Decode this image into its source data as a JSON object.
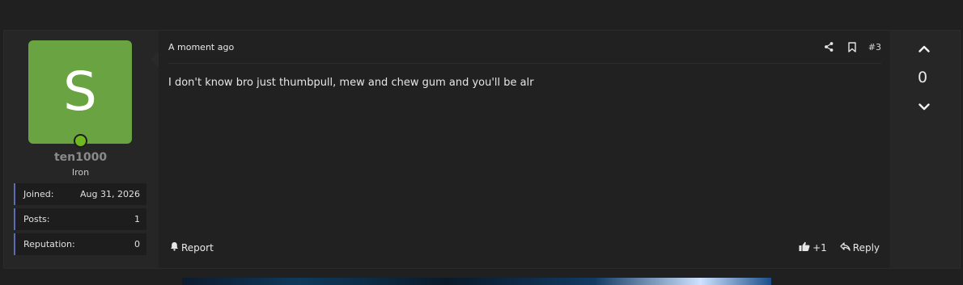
{
  "post": {
    "user": {
      "avatar_letter": "S",
      "avatar_color": "#6aa341",
      "online_status_color": "#6fb81f",
      "username": "ten1000",
      "title": "Iron",
      "stats": [
        {
          "label": "Joined:",
          "value": "Aug 31, 2026"
        },
        {
          "label": "Posts:",
          "value": "1"
        },
        {
          "label": "Reputation:",
          "value": "0"
        }
      ]
    },
    "time": "A moment ago",
    "number": "#3",
    "message": "I don't know bro just thumbpull, mew and chew gum and you'll be alr",
    "actions": {
      "report": "Report",
      "like_count": "+1",
      "reply": "Reply"
    },
    "icons": [
      "share-icon",
      "bookmark-icon",
      "bell-icon",
      "thumbs-up-icon",
      "reply-icon",
      "chevron-up-icon",
      "chevron-down-icon"
    ],
    "vote": {
      "count": "0"
    }
  }
}
